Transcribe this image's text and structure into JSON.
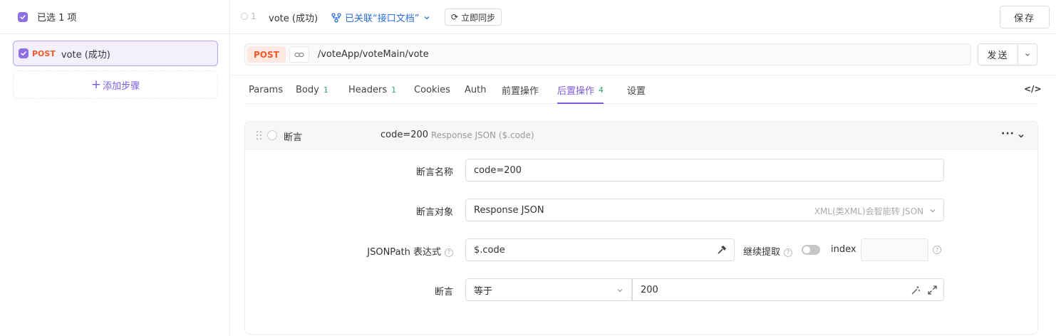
{
  "left": {
    "selected_label": "已选 1 项",
    "step": {
      "method": "POST",
      "name": "vote (成功)"
    },
    "add_step_label": "添加步骤"
  },
  "topbar": {
    "order": "1",
    "name": "vote (成功)",
    "linked_label": "已关联“接口文档”",
    "sync_label": "立即同步",
    "save_label": "保存"
  },
  "request": {
    "method": "POST",
    "url": "/voteApp/voteMain/vote",
    "send_label": "发送"
  },
  "tabs": [
    {
      "label": "Params",
      "count": ""
    },
    {
      "label": "Body",
      "count": "1"
    },
    {
      "label": "Headers",
      "count": "1"
    },
    {
      "label": "Cookies",
      "count": ""
    },
    {
      "label": "Auth",
      "count": ""
    },
    {
      "label": "前置操作",
      "count": ""
    },
    {
      "label": "后置操作",
      "count": "4"
    },
    {
      "label": "设置",
      "count": ""
    }
  ],
  "active_tab": "后置操作",
  "assertion": {
    "type_label": "断言",
    "name": "code=200",
    "desc": "Response JSON ($.code)",
    "fields": {
      "name_label": "断言名称",
      "name_value": "code=200",
      "target_label": "断言对象",
      "target_value": "Response JSON",
      "target_hint": "XML(类XML)会智能转 JSON",
      "jsonpath_label": "JSONPath 表达式",
      "jsonpath_value": "$.code",
      "continue_label": "继续提取",
      "index_label": "index",
      "index_value": "",
      "assert_label": "断言",
      "operator_value": "等于",
      "expected_value": "200"
    }
  },
  "colors": {
    "accent": "#7c5ce0",
    "post": "#f05a28",
    "link": "#2d6fd8",
    "count": "#2fa36b"
  }
}
